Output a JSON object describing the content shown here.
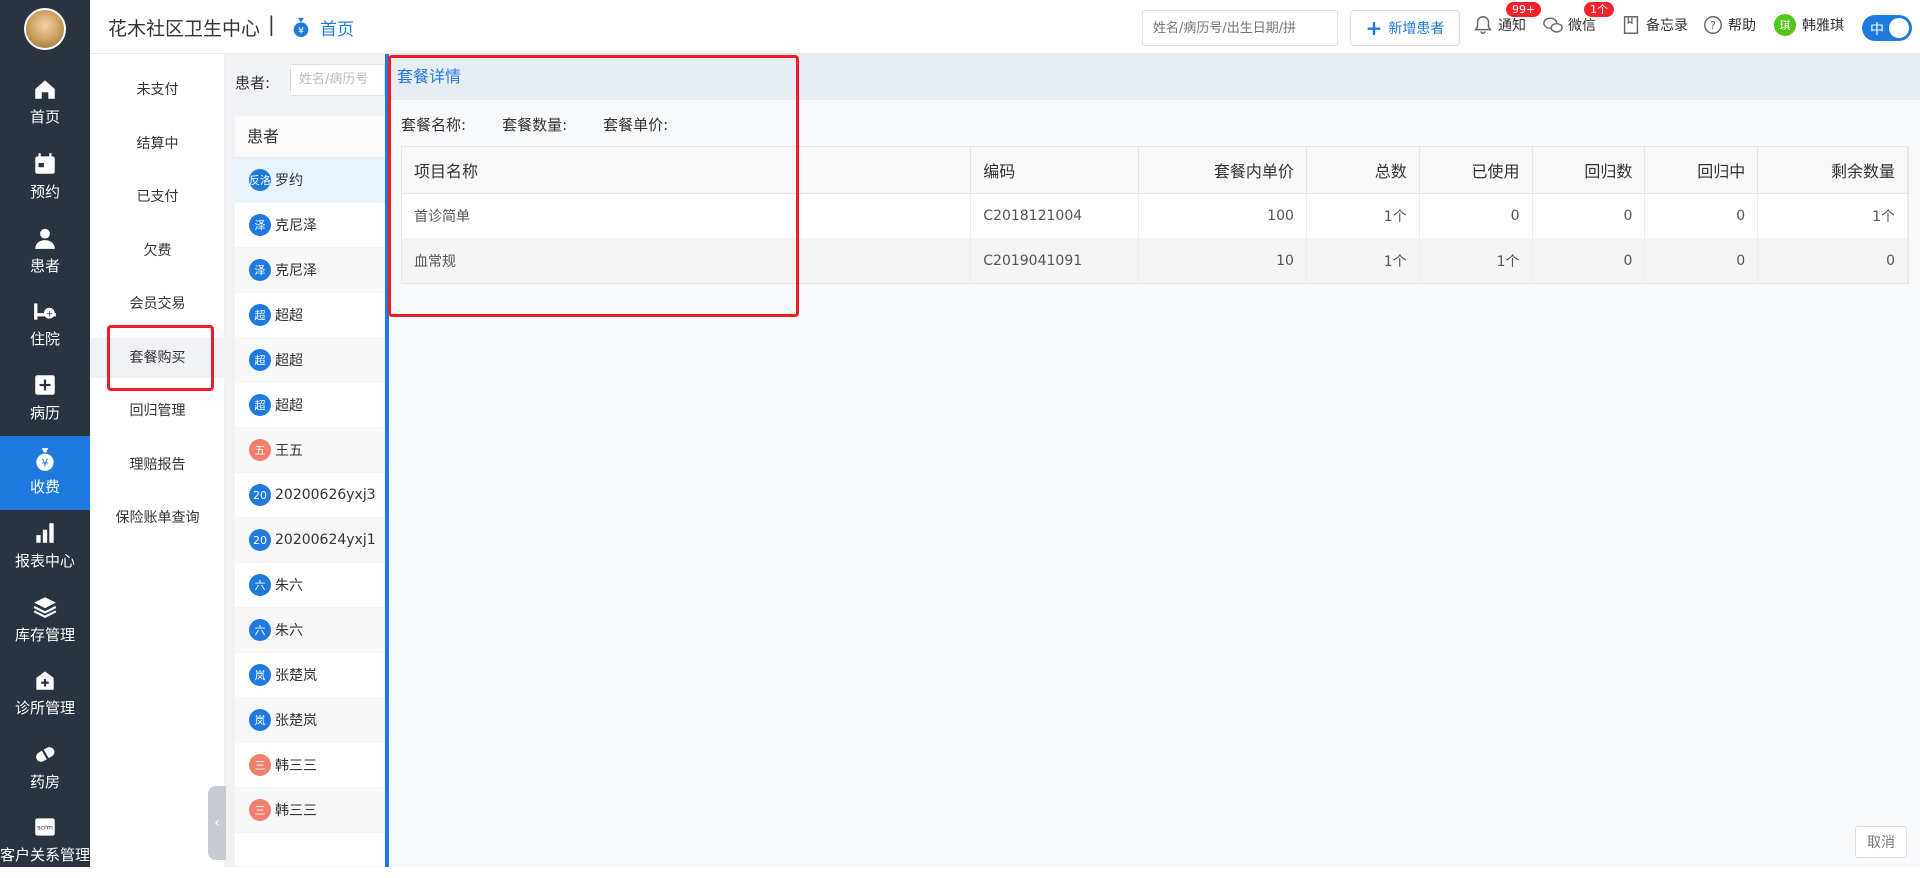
{
  "header": {
    "org_name": "花木社区卫生中心",
    "separator": "|",
    "home_tab": "首页",
    "search_placeholder": "姓名/病历号/出生日期/拼",
    "new_patient": "新增患者",
    "notify": "通知",
    "notify_badge": "99+",
    "wechat": "微信",
    "wechat_badge": "1个",
    "memo": "备忘录",
    "help": "帮助",
    "user_initial": "琪",
    "user_name": "韩雅琪",
    "lang_toggle": "中"
  },
  "nav": [
    {
      "label": "首页",
      "icon": "home-icon"
    },
    {
      "label": "预约",
      "icon": "calendar-icon"
    },
    {
      "label": "患者",
      "icon": "user-icon"
    },
    {
      "label": "住院",
      "icon": "bed-icon"
    },
    {
      "label": "病历",
      "icon": "medical-record-icon"
    },
    {
      "label": "收费",
      "icon": "money-bag-icon",
      "active": true
    },
    {
      "label": "报表中心",
      "icon": "bar-chart-icon"
    },
    {
      "label": "库存管理",
      "icon": "layers-icon"
    },
    {
      "label": "诊所管理",
      "icon": "clinic-icon"
    },
    {
      "label": "药房",
      "icon": "pill-icon"
    },
    {
      "label": "客户关系管理",
      "icon": "crm-icon"
    }
  ],
  "subnav": [
    "未支付",
    "结算中",
    "已支付",
    "欠费",
    "会员交易",
    "套餐购买",
    "回归管理",
    "理赔报告",
    "保险账单查询"
  ],
  "patients": {
    "label": "患者:",
    "input_placeholder": "姓名/病历号",
    "header": "患者",
    "rows": [
      {
        "avatar": "反洛",
        "name": "罗约"
      },
      {
        "avatar": "泽",
        "name": "克尼泽"
      },
      {
        "avatar": "泽",
        "name": "克尼泽"
      },
      {
        "avatar": "超",
        "name": "超超"
      },
      {
        "avatar": "超",
        "name": "超超"
      },
      {
        "avatar": "超",
        "name": "超超"
      },
      {
        "avatar": "五",
        "name": "王五",
        "red": true
      },
      {
        "avatar": "20",
        "name": "20200626yxj3"
      },
      {
        "avatar": "20",
        "name": "20200624yxj1"
      },
      {
        "avatar": "六",
        "name": "朱六"
      },
      {
        "avatar": "六",
        "name": "朱六"
      },
      {
        "avatar": "岚",
        "name": "张楚岚"
      },
      {
        "avatar": "岚",
        "name": "张楚岚"
      },
      {
        "avatar": "三",
        "name": "韩三三",
        "red": true
      },
      {
        "avatar": "三",
        "name": "韩三三",
        "red": true
      }
    ]
  },
  "detail": {
    "title": "套餐详情",
    "package_name_label": "套餐名称:",
    "package_qty_label": "套餐数量:",
    "package_price_label": "套餐单价:",
    "columns": [
      "项目名称",
      "编码",
      "套餐内单价",
      "总数",
      "已使用",
      "回归数",
      "回归中",
      "剩余数量"
    ],
    "rows": [
      [
        "首诊简单",
        "C2018121004",
        "100",
        "1个",
        "0",
        "0",
        "0",
        "1个"
      ],
      [
        "血常规",
        "C2019041091",
        "10",
        "1个",
        "1个",
        "0",
        "0",
        "0"
      ]
    ],
    "cancel": "取消"
  }
}
